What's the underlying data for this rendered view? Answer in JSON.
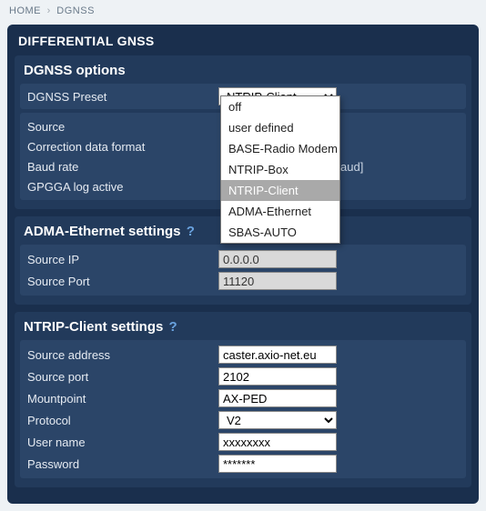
{
  "breadcrumb": {
    "home": "HOME",
    "current": "DGNSS"
  },
  "panel_title": "DIFFERENTIAL GNSS",
  "dgnss_options": {
    "title": "DGNSS options",
    "preset_label": "DGNSS Preset",
    "preset_value": "NTRIP-Client",
    "preset_options": [
      "off",
      "user defined",
      "BASE-Radio Modem",
      "NTRIP-Box",
      "NTRIP-Client",
      "ADMA-Ethernet",
      "SBAS-AUTO"
    ],
    "source_label": "Source",
    "correction_label": "Correction data format",
    "baud_label": "Baud rate",
    "baud_unit": "aud]",
    "gpgga_label": "GPGGA log active"
  },
  "adma": {
    "title": "ADMA-Ethernet settings",
    "help": "?",
    "ip_label": "Source IP",
    "ip_value": "0.0.0.0",
    "port_label": "Source Port",
    "port_value": "11120"
  },
  "ntrip": {
    "title": "NTRIP-Client settings",
    "help": "?",
    "addr_label": "Source address",
    "addr_value": "caster.axio-net.eu",
    "port_label": "Source port",
    "port_value": "2102",
    "mount_label": "Mountpoint",
    "mount_value": "AX-PED",
    "proto_label": "Protocol",
    "proto_value": "V2",
    "user_label": "User name",
    "user_value": "xxxxxxxx",
    "pass_label": "Password",
    "pass_value": "*******"
  }
}
